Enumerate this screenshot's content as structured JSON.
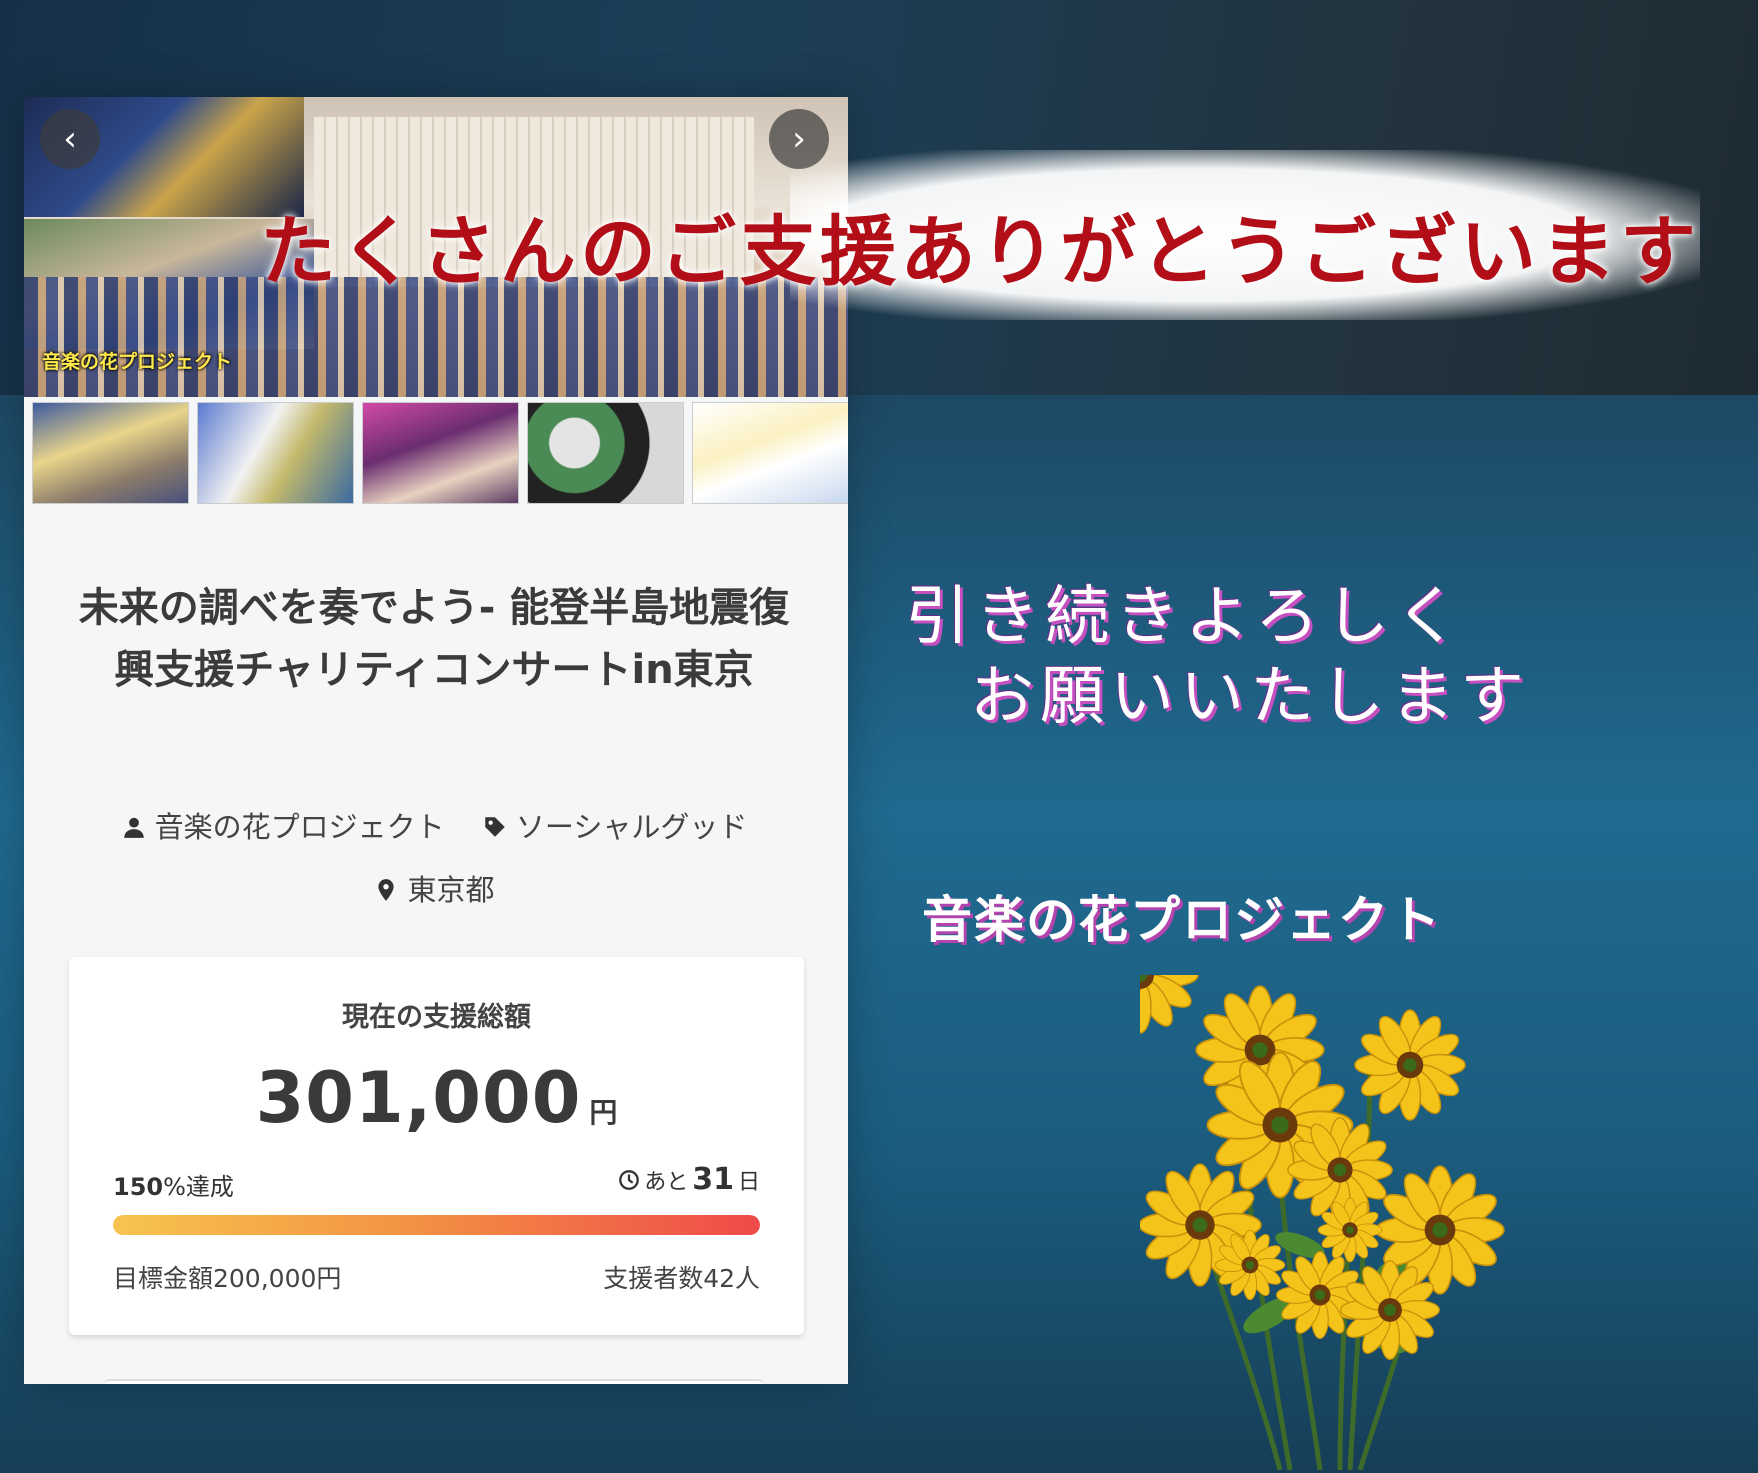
{
  "hero": {
    "brand_label": "音楽の花プロジェクト",
    "prev_icon": "chevron-left-icon",
    "next_icon": "chevron-right-icon"
  },
  "project": {
    "title": "未来の調べを奏でよう- 能登半島地震復興支援チャリティコンサートin東京",
    "owner": "音楽の花プロジェクト",
    "category": "ソーシャルグッド",
    "location": "東京都"
  },
  "funding": {
    "label": "現在の支援総額",
    "amount": "301,000",
    "unit": "円",
    "percent": "150",
    "percent_suffix": "%達成",
    "progress": 1.0,
    "days_prefix": "あと",
    "days_left": "31",
    "days_unit": "日",
    "goal": "目標金額200,000円",
    "backers": "支援者数42人"
  },
  "overlay": {
    "thanks": "たくさんのご支援ありがとうございます",
    "continue_line1": "引き続きよろしく",
    "continue_line2": "お願いいたします",
    "organization": "音楽の花プロジェクト"
  },
  "colors": {
    "thanks_text": "#b10e18",
    "progress_start": "#f7c44f",
    "progress_end": "#ef4a4a",
    "flower": "#f5c41a"
  }
}
